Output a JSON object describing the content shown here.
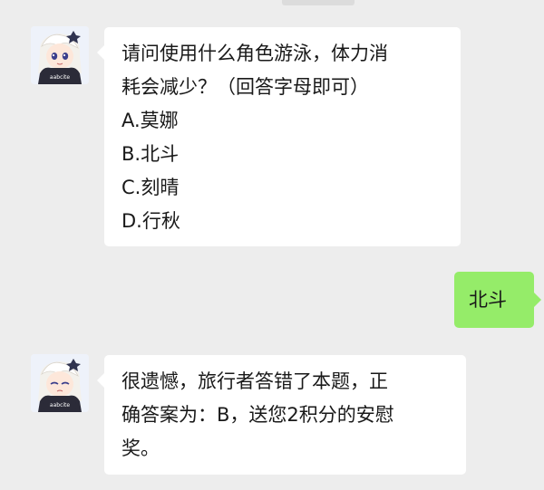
{
  "chat": {
    "messages": [
      {
        "sender": "bot",
        "avatar_tag": "aabcite",
        "lines": [
          "请问使用什么角色游泳，体力消",
          "耗会减少？（回答字母即可）",
          "A.莫娜",
          "B.北斗",
          "C.刻晴",
          "D.行秋"
        ]
      },
      {
        "sender": "user",
        "text": "北斗"
      },
      {
        "sender": "bot",
        "avatar_tag": "aabcite",
        "lines": [
          "很遗憾，旅行者答错了本题，正",
          "确答案为：B，送您2积分的安慰",
          "奖。"
        ]
      }
    ]
  },
  "colors": {
    "background": "#ededed",
    "incoming_bubble": "#ffffff",
    "outgoing_bubble": "#95ec69",
    "text": "#191919"
  },
  "icons": {
    "avatar": "paimon-avatar-icon"
  }
}
